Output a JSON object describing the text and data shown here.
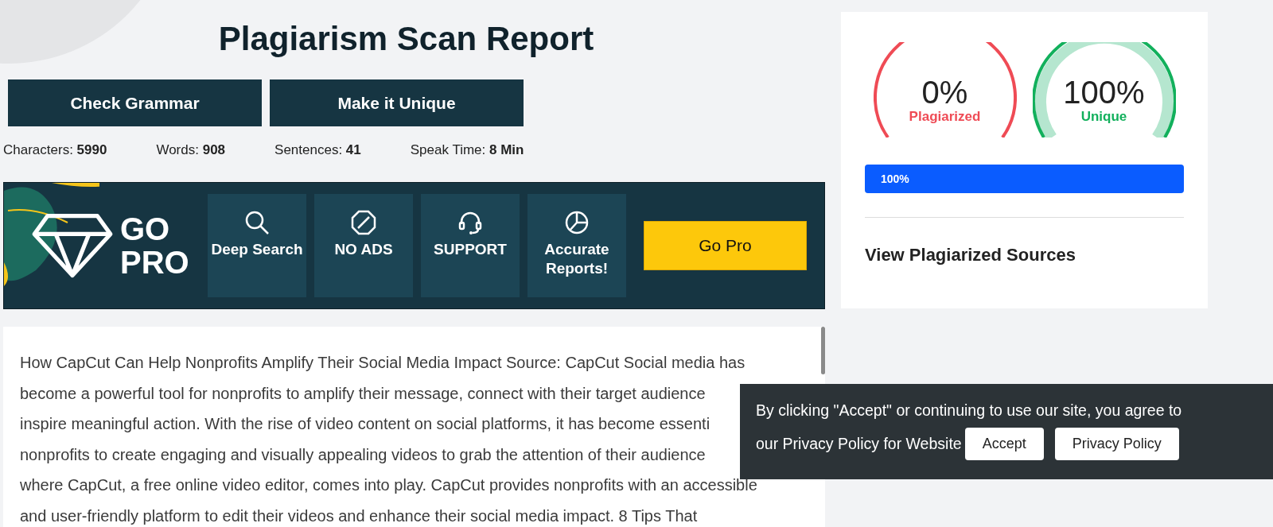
{
  "title": "Plagiarism Scan Report",
  "actions": [
    "Check Grammar",
    "Make it Unique"
  ],
  "stats": [
    {
      "label": "Characters:",
      "value": "5990"
    },
    {
      "label": "Words:",
      "value": "908"
    },
    {
      "label": "Sentences:",
      "value": "41"
    },
    {
      "label": "Speak Time:",
      "value": "8 Min"
    }
  ],
  "promo": {
    "heading_lines": [
      "GO",
      "PRO"
    ],
    "features": [
      {
        "kind": "search",
        "label": "Deep Search"
      },
      {
        "kind": "no-ads",
        "label": "NO ADS"
      },
      {
        "kind": "support",
        "label": "SUPPORT"
      },
      {
        "kind": "reports",
        "label": "Accurate Reports!"
      }
    ],
    "button": "Go Pro"
  },
  "text_lines": [
    "How CapCut Can Help Nonprofits Amplify Their Social Media Impact Source: CapCut Social media has",
    "become a powerful tool for nonprofits to amplify their message, connect with their target audience",
    "inspire meaningful action. With the rise of video content on social platforms, it has become essenti",
    "nonprofits to create engaging and visually appealing videos to grab the attention of their audience",
    "where CapCut, a free online video editor, comes into play. CapCut provides nonprofits with an accessible",
    "and user-friendly platform to edit their videos and enhance their social media impact. 8 Tips That"
  ],
  "results": {
    "gauges": [
      {
        "kind": "plagiarized",
        "value": "0%",
        "label": "Plagiarized",
        "color": "#ef4b55"
      },
      {
        "kind": "unique",
        "value": "100%",
        "label": "Unique",
        "color": "#12b05c"
      }
    ],
    "progress": {
      "level": 1,
      "reading": "100%"
    },
    "sources_link": "View Plagiarized Sources"
  },
  "cookie": {
    "lines": [
      "By clicking \"Accept\" or continuing to use our site, you agree to",
      "our Privacy Policy for Website"
    ],
    "buttons": [
      "Accept",
      "Privacy Policy"
    ]
  }
}
